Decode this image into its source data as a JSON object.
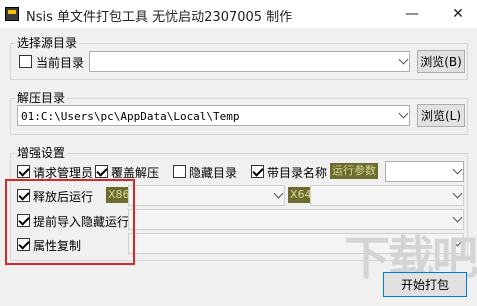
{
  "window": {
    "title": "Nsis 单文件打包工具 无忧启动2307005 制作",
    "minimize_glyph": "—",
    "close_glyph": "✕"
  },
  "source_group": {
    "title": "选择源目录",
    "current_dir_label": "当前目录",
    "current_dir_checked": false,
    "path_value": "",
    "browse_label": "浏览(B)"
  },
  "extract_group": {
    "title": "解压目录",
    "path_value": "01:C:\\Users\\pc\\AppData\\Local\\Temp",
    "browse_label": "浏览(L)"
  },
  "enhance_group": {
    "title": "增强设置",
    "options": [
      {
        "label": "请求管理员",
        "checked": true
      },
      {
        "label": "覆盖解压",
        "checked": true
      },
      {
        "label": "隐藏目录",
        "checked": false
      },
      {
        "label": "带目录名称",
        "checked": true
      }
    ],
    "run_params_tag": "运行参数",
    "run_params_value": "",
    "run_after_label": "释放后运行",
    "run_after_checked": true,
    "x86_tag": "X86",
    "x64_tag": "X64",
    "pre_import_label": "提前导入隐藏运行",
    "pre_import_checked": true,
    "attr_copy_label": "属性复制",
    "attr_copy_checked": true
  },
  "watermark": "下载吧",
  "start_button_label": "开始打包",
  "colors": {
    "highlight_box": "#d42a2a",
    "tag_bg": "#6b6b2e",
    "tag_text": "#d8d89a",
    "default_button_border": "#0078d7"
  }
}
